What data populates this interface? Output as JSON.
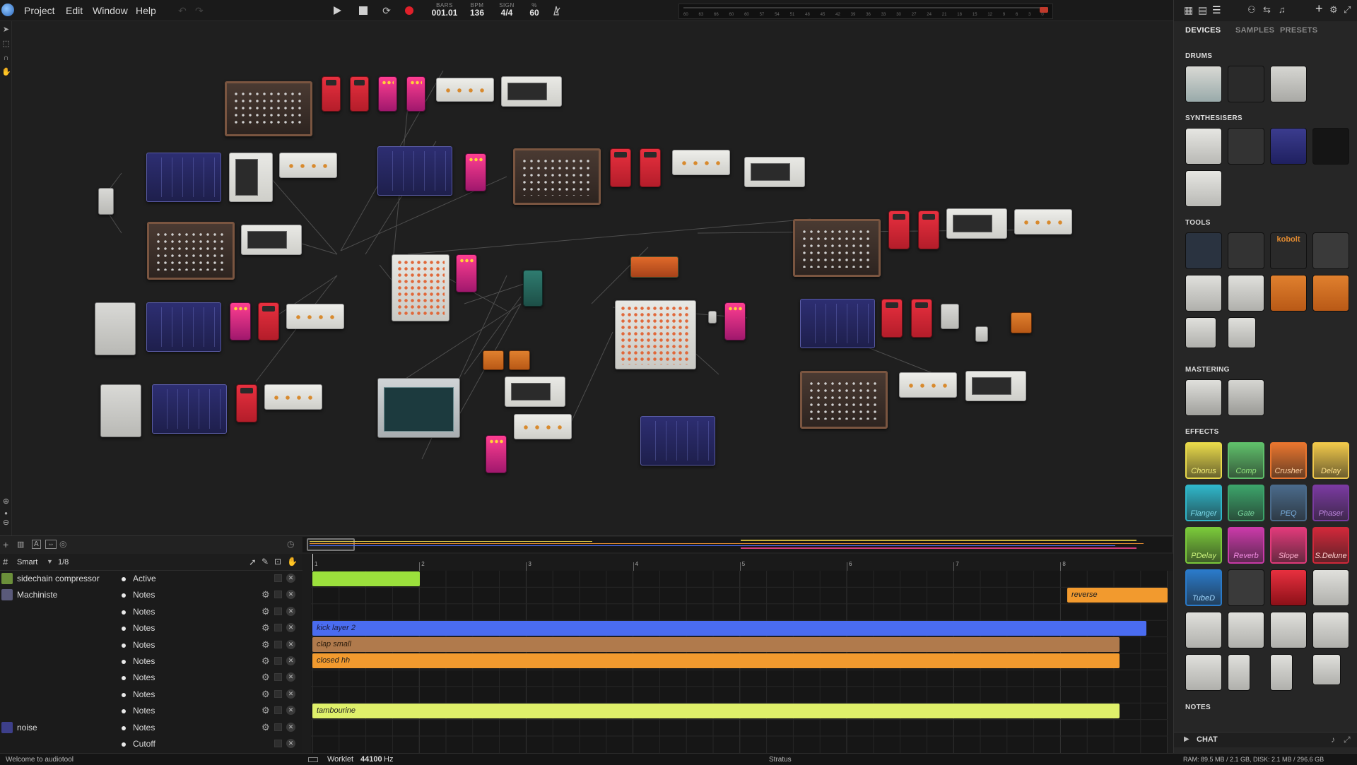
{
  "menu": {
    "project": "Project",
    "edit": "Edit",
    "window": "Window",
    "help": "Help"
  },
  "transport": {
    "bars_label": "BARS",
    "bars_value": "001.01",
    "bpm_label": "BPM",
    "bpm_value": "136",
    "sign_label": "SIGN",
    "sign_value": "4/4",
    "pct_label": "%",
    "pct_value": "60"
  },
  "meter_ticks": [
    "60",
    "63",
    "66",
    "60",
    "60",
    "57",
    "54",
    "51",
    "48",
    "45",
    "42",
    "39",
    "36",
    "33",
    "30",
    "27",
    "24",
    "21",
    "18",
    "15",
    "12",
    "9",
    "6",
    "3",
    "0"
  ],
  "right_panel": {
    "tabs": [
      "DEVICES",
      "SAMPLES",
      "PRESETS"
    ],
    "active_tab": "DEVICES",
    "sections": {
      "drums": "DRUMS",
      "synths": "SYNTHESISERS",
      "tools": "TOOLS",
      "mastering": "MASTERING",
      "effects": "EFFECTS",
      "notes": "NOTES"
    },
    "tool_labels": [
      "kobolt"
    ],
    "effects": [
      "Chorus",
      "Comp",
      "Crusher",
      "Delay",
      "Flanger",
      "Gate",
      "PEQ",
      "Phaser",
      "PDelay",
      "Reverb",
      "Slope",
      "S.Delune",
      "TubeD"
    ],
    "chat": "CHAT"
  },
  "timeline": {
    "header": {
      "mode": "Smart",
      "quantize": "1/8"
    },
    "ruler": [
      "1",
      "2",
      "3",
      "4",
      "5",
      "6",
      "7",
      "8"
    ],
    "tracks": [
      {
        "name": "sidechain compressor",
        "param": "Active"
      },
      {
        "name": "Machiniste",
        "param": "Notes"
      },
      {
        "name": "",
        "param": "Notes"
      },
      {
        "name": "",
        "param": "Notes"
      },
      {
        "name": "",
        "param": "Notes"
      },
      {
        "name": "",
        "param": "Notes"
      },
      {
        "name": "",
        "param": "Notes"
      },
      {
        "name": "",
        "param": "Notes"
      },
      {
        "name": "",
        "param": "Notes"
      },
      {
        "name": "noise",
        "param": "Notes"
      },
      {
        "name": "",
        "param": "Cutoff"
      }
    ],
    "clips": {
      "reverse": "reverse",
      "kick": "kick layer 2",
      "clap": "clap small",
      "hh": "closed hh",
      "tamb": "tambourine"
    }
  },
  "status": {
    "welcome": "Welcome to audiotool",
    "engine": "Worklet",
    "samplerate": "44100",
    "unit": "Hz",
    "server": "Stratus",
    "stats": "RAM: 89.5 MB / 2.1 GB, DISK: 2.1 MB / 296.6 GB"
  },
  "colors": {
    "green_clip": "#9be03c",
    "orange_clip": "#f29a2e",
    "blue_clip": "#4a6cf0",
    "brown_clip": "#b07a4c",
    "yellow_clip": "#dff06a",
    "record": "#e0202a"
  }
}
